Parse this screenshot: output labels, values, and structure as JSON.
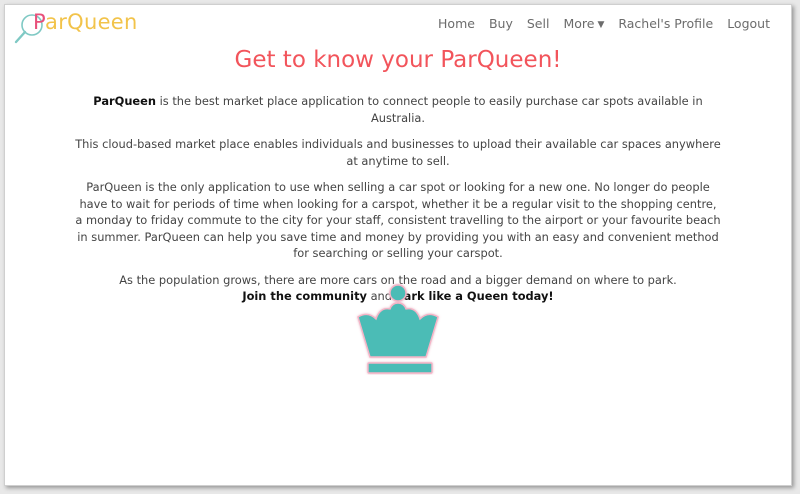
{
  "logo": {
    "first_letter": "P",
    "rest": "arQueen",
    "icon": "magnifier-icon"
  },
  "nav": {
    "items": [
      {
        "label": "Home"
      },
      {
        "label": "Buy"
      },
      {
        "label": "Sell"
      },
      {
        "label": "More",
        "dropdown": true
      },
      {
        "label": "Rachel's Profile"
      },
      {
        "label": "Logout"
      }
    ]
  },
  "page": {
    "title": "Get to know your ParQueen!",
    "p1_brand": "ParQueen",
    "p1_rest": " is the best market place application to connect people to easily purchase car spots available in Australia.",
    "p2": "This cloud-based market place enables individuals and businesses to upload their available car spaces anywhere at anytime to sell.",
    "p3": "ParQueen is the only application to use when selling a car spot or looking for a new one. No longer do people have to wait for periods of time when looking for a carspot, whether it be a regular visit to the shopping centre, a monday to friday commute to the city for your staff, consistent travelling to the airport or your favourite beach in summer. ParQueen can help you save time and money by providing you with an easy and convenient method for searching or selling your carspot.",
    "p4_line1": "As the population grows, there are more cars on the road and a bigger demand on where to park.",
    "p4_join": "Join the community",
    "p4_and": " and ",
    "p4_park": "Park like a Queen today!"
  },
  "colors": {
    "title": "#f2545b",
    "crown": "#4cbcb6",
    "crown_glow": "#f6b3c6",
    "logo_p": "#e84f7a",
    "logo_rest": "#f2c34a"
  },
  "crown_icon": "crown-icon"
}
